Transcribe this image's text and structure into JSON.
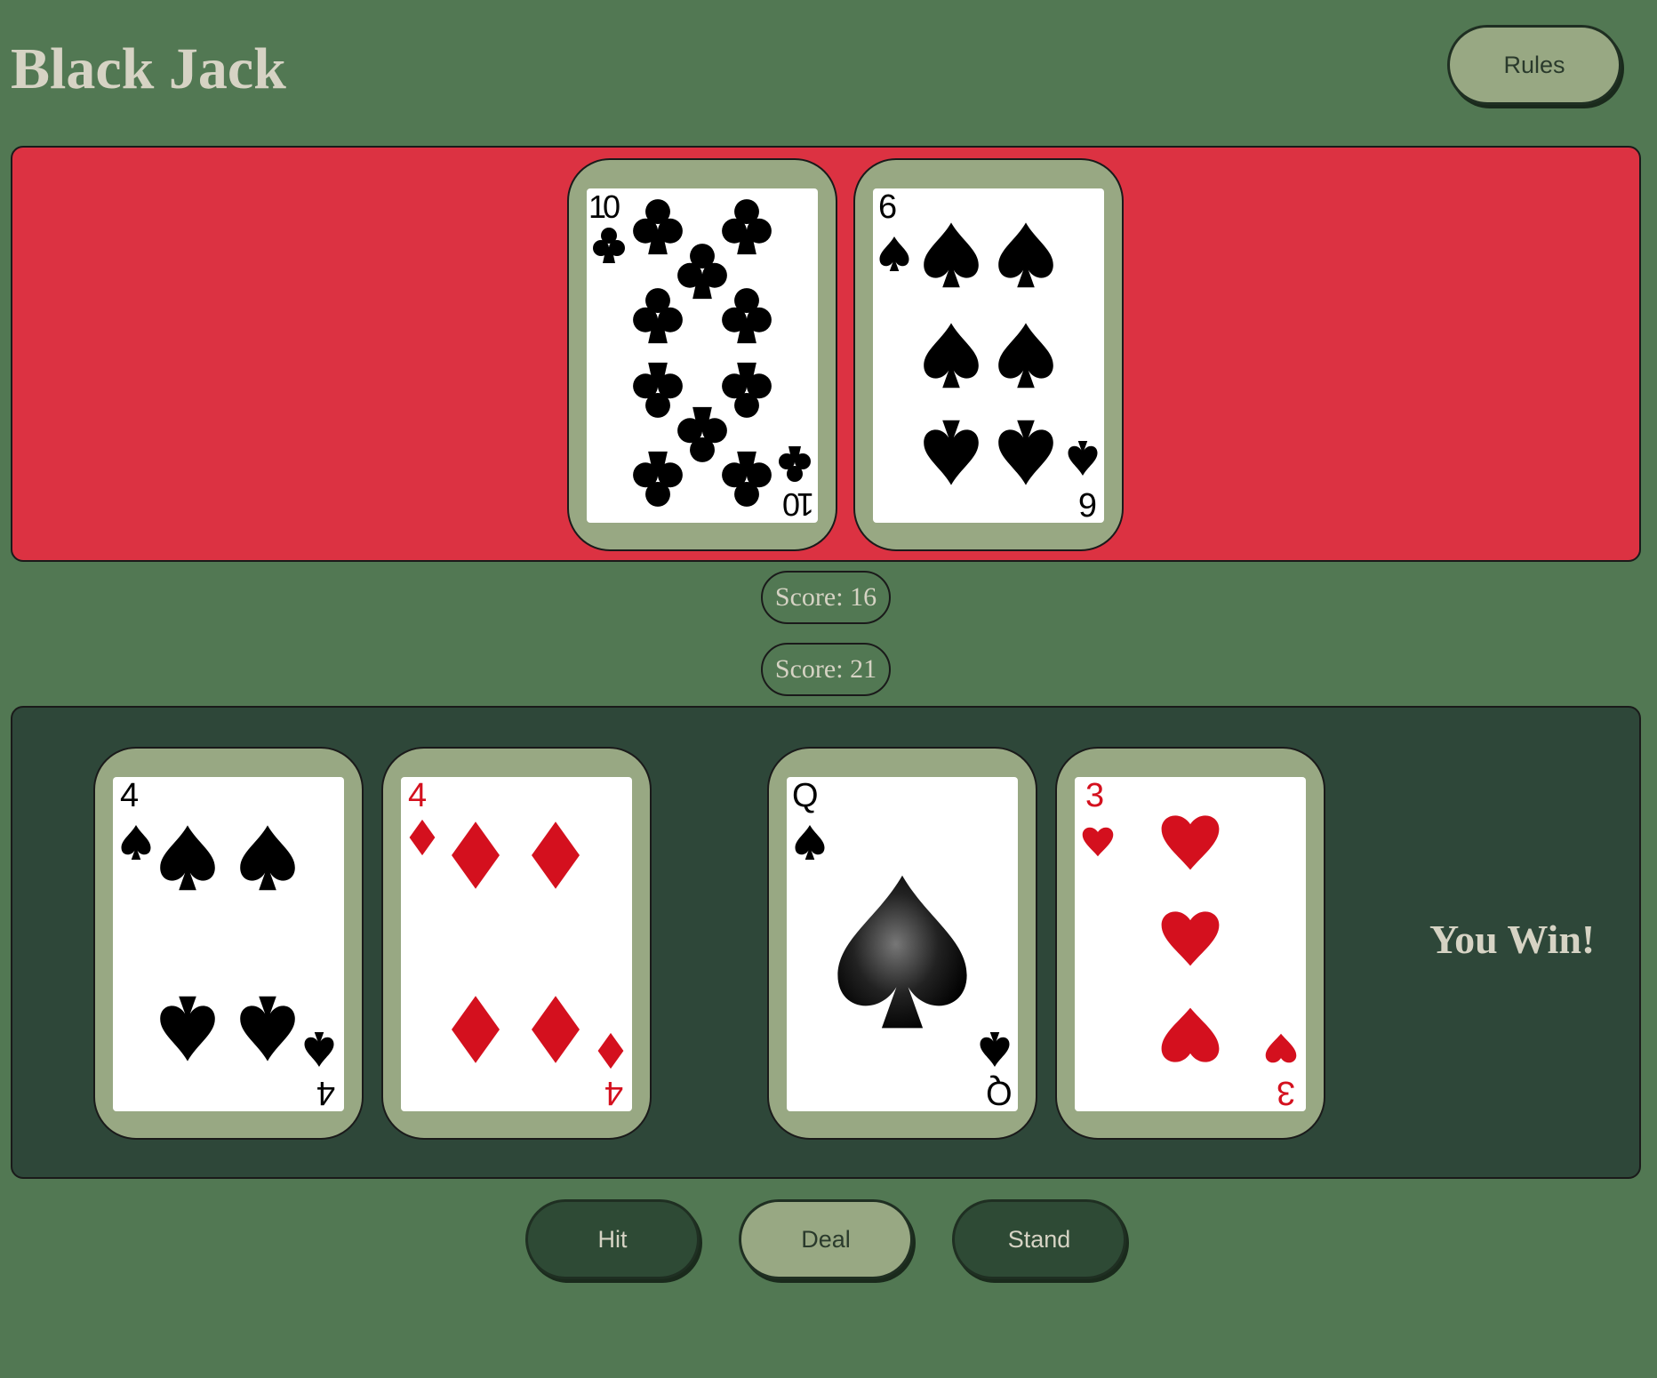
{
  "header": {
    "title": "Black Jack",
    "rules_label": "Rules"
  },
  "dealer": {
    "score_label": "Score: 16",
    "cards": [
      {
        "rank": "10",
        "suit": "clubs"
      },
      {
        "rank": "6",
        "suit": "spades"
      }
    ]
  },
  "player": {
    "score_label": "Score: 21",
    "result": "You Win!",
    "cards": [
      {
        "rank": "4",
        "suit": "spades"
      },
      {
        "rank": "4",
        "suit": "diamonds"
      },
      {
        "rank": "Q",
        "suit": "spades"
      },
      {
        "rank": "3",
        "suit": "hearts"
      }
    ]
  },
  "controls": {
    "hit_label": "Hit",
    "deal_label": "Deal",
    "stand_label": "Stand"
  },
  "colors": {
    "table": "#527853",
    "dealer_area": "#dc3242",
    "player_area": "#2e4739",
    "card_frame": "#98a883",
    "text": "#d6d3c4",
    "red_suit": "#d4101e",
    "black_suit": "#000000"
  }
}
